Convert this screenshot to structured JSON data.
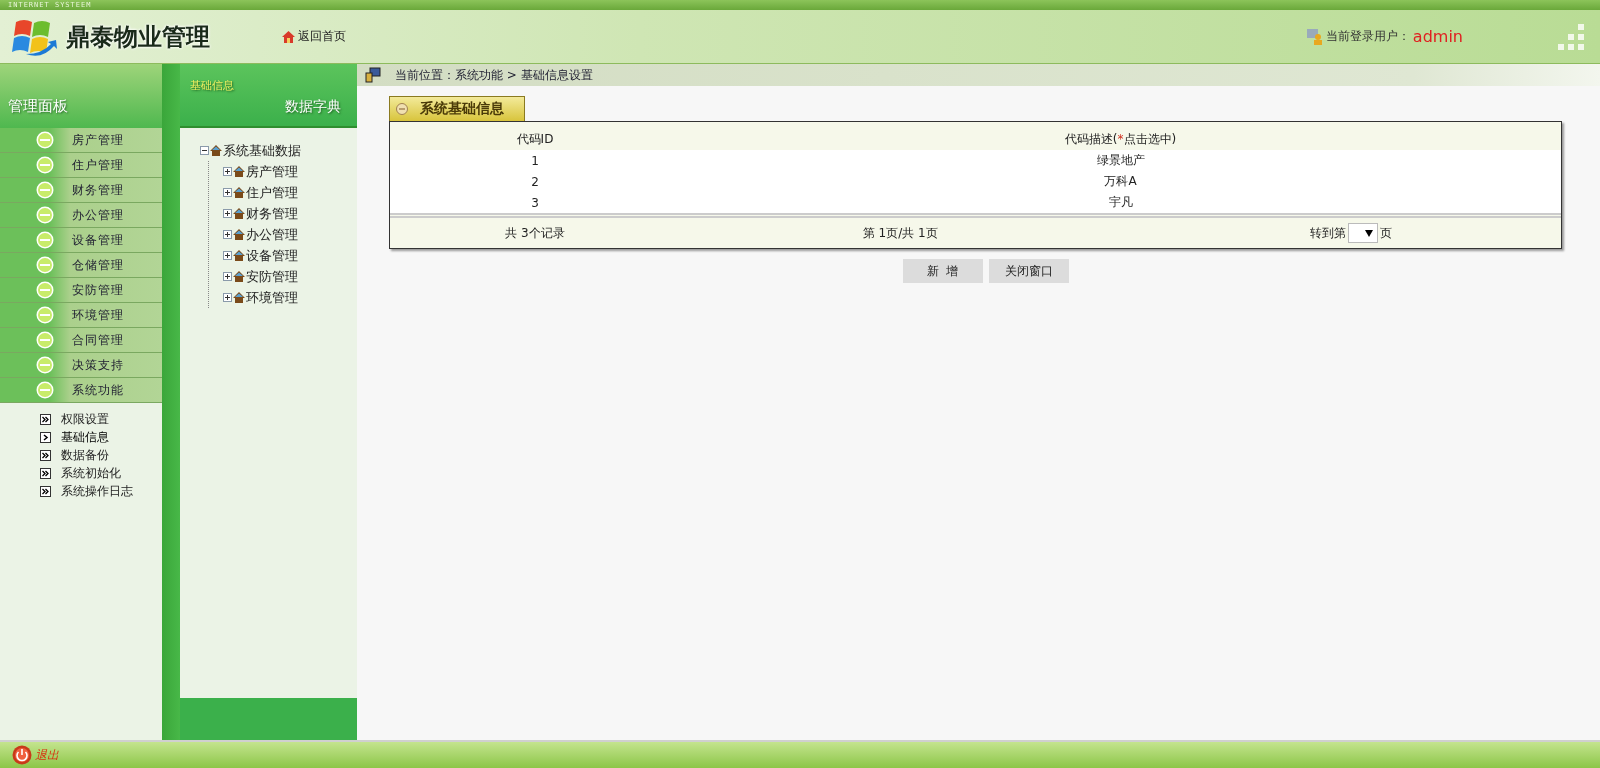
{
  "top_strip": {
    "title": "INTERNET SYSTEEM"
  },
  "header": {
    "logo_text": "鼎泰物业管理",
    "home_link": "返回首页",
    "user_label": "当前登录用户：",
    "user_name": "admin"
  },
  "sidebar": {
    "title": "管理面板",
    "menu": [
      {
        "label": "房产管理"
      },
      {
        "label": "住户管理"
      },
      {
        "label": "财务管理"
      },
      {
        "label": "办公管理"
      },
      {
        "label": "设备管理"
      },
      {
        "label": "仓储管理"
      },
      {
        "label": "安防管理"
      },
      {
        "label": "环境管理"
      },
      {
        "label": "合同管理"
      },
      {
        "label": "决策支持"
      },
      {
        "label": "系统功能"
      }
    ],
    "submenu": [
      {
        "label": "权限设置",
        "selected": false
      },
      {
        "label": "基础信息",
        "selected": true
      },
      {
        "label": "数据备份",
        "selected": false
      },
      {
        "label": "系统初始化",
        "selected": false
      },
      {
        "label": "系统操作日志",
        "selected": false
      }
    ]
  },
  "dictionary_panel": {
    "tabs": [
      {
        "label": "基础信息",
        "selected": true
      },
      {
        "label": "数据字典",
        "selected": false
      }
    ],
    "tree": {
      "label": "系统基础数据",
      "expanded": true,
      "children": [
        {
          "label": "房产管理",
          "expanded": false
        },
        {
          "label": "住户管理",
          "expanded": false
        },
        {
          "label": "财务管理",
          "expanded": false
        },
        {
          "label": "办公管理",
          "expanded": false
        },
        {
          "label": "设备管理",
          "expanded": false
        },
        {
          "label": "安防管理",
          "expanded": false
        },
        {
          "label": "环境管理",
          "expanded": false
        }
      ]
    }
  },
  "breadcrumb": {
    "label": "当前位置：",
    "path": "系统功能 > 基础信息设置"
  },
  "panel": {
    "title": "系统基础信息",
    "columns": [
      {
        "text": "代码ID"
      },
      {
        "text": "代码描述(",
        "required_mark": "*",
        "hint": "点击选中)"
      }
    ],
    "rows": [
      {
        "id": "1",
        "description": "绿景地产"
      },
      {
        "id": "2",
        "description": "万科A"
      },
      {
        "id": "3",
        "description": "宇凡"
      }
    ],
    "footer": {
      "count": "共 3个记录",
      "page": "第 1页/共 1页",
      "goto_label": "转到第",
      "goto_suffix": "页"
    }
  },
  "buttons": [
    "新  增",
    "关闭窗口"
  ],
  "bottom_bar": {
    "logout": "退出"
  }
}
